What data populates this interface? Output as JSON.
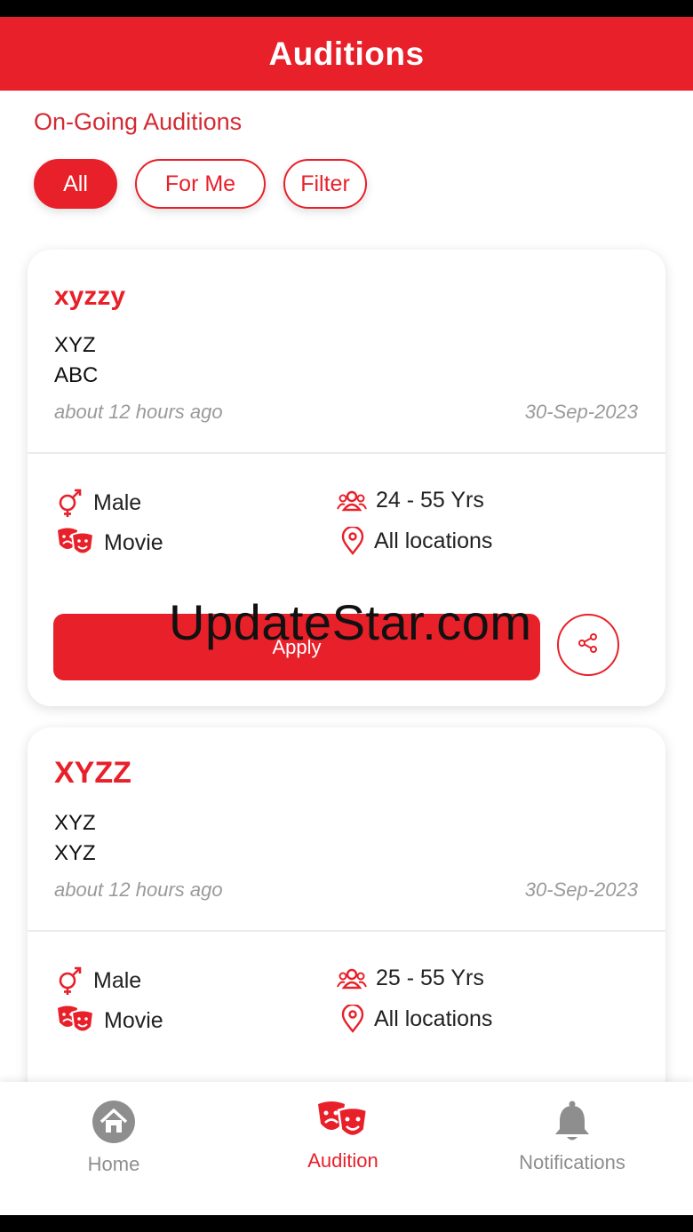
{
  "header": {
    "title": "Auditions"
  },
  "section_title": "On-Going Auditions",
  "chips": [
    {
      "label": "All",
      "active": true
    },
    {
      "label": "For Me",
      "active": false
    },
    {
      "label": "Filter",
      "active": false
    }
  ],
  "cards": [
    {
      "title": "xyzzy",
      "line1": "XYZ",
      "line2": "ABC",
      "posted": "about 12 hours ago",
      "date": "30-Sep-2023",
      "gender": "Male",
      "age": "24 - 55 Yrs",
      "category": "Movie",
      "location": "All locations",
      "apply_label": "Apply"
    },
    {
      "title": "XYZZ",
      "line1": "XYZ",
      "line2": "XYZ",
      "posted": "about 12 hours ago",
      "date": "30-Sep-2023",
      "gender": "Male",
      "age": "25 - 55 Yrs",
      "category": "Movie",
      "location": "All locations"
    }
  ],
  "watermark": "UpdateStar.com",
  "bottom_nav": [
    {
      "label": "Home",
      "icon": "home-icon",
      "active": false
    },
    {
      "label": "Audition",
      "icon": "theater-masks-icon",
      "active": true
    },
    {
      "label": "Notifications",
      "icon": "bell-icon",
      "active": false
    }
  ],
  "colors": {
    "accent": "#e8202a",
    "muted": "#9a9a9a",
    "nav_inactive": "#8e8e8e"
  }
}
